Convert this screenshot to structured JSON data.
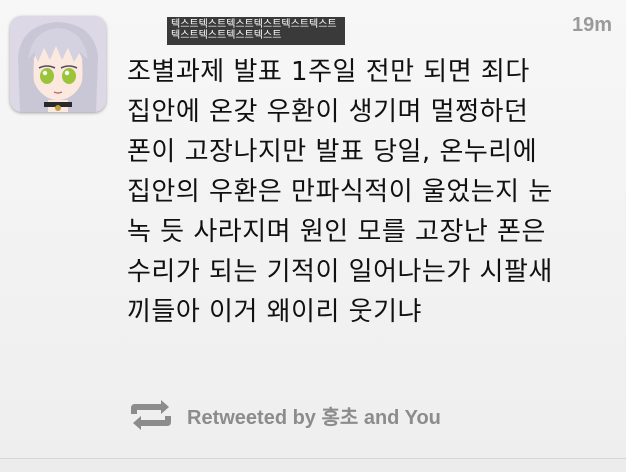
{
  "tweet": {
    "username": "텍스트텍스트텍스트텍스트텍스트텍스트텍스트텍스트텍스트텍스트",
    "timestamp": "19m",
    "text_lines": [
      "조별과제 발표 1주일 전만 되면 죄다",
      "집안에 온갖 우환이 생기며 멀쩡하던",
      "폰이 고장나지만 발표 당일, 온누리에",
      "집안의 우환은 만파식적이 울었는지 눈",
      "녹 듯 사라지며 원인 모를 고장난 폰은",
      "수리가 되는 기적이 일어나는가 시팔새",
      "끼들아 이거 왜이리 웃기냐"
    ],
    "retweet_status": "Retweeted by 홍초 and You",
    "avatar_icon": "anime-avatar-icon",
    "retweet_icon": "retweet-icon"
  },
  "colors": {
    "text": "#111111",
    "muted": "#9a9a9a",
    "retweet": "#8c8c8c"
  }
}
